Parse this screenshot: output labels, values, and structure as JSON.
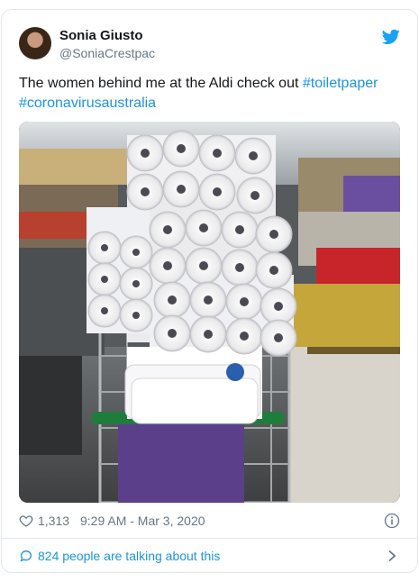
{
  "tweet": {
    "display_name": "Sonia Giusto",
    "handle": "@SoniaCrestpac",
    "text_plain": "The women behind me at the Aldi check out ",
    "hashtag_1": "#toiletpaper",
    "hashtag_2": "#coronavirusaustralia",
    "like_count": "1,313",
    "timestamp": "9:29 AM - Mar 3, 2020",
    "talking_text": "824 people are talking about this"
  },
  "icons": {
    "brand": "twitter-bird-icon",
    "like": "heart-icon",
    "info": "info-icon",
    "reply": "speech-bubble-icon",
    "chevron": "chevron-right-icon"
  },
  "colors": {
    "link": "#1b95e0",
    "meta": "#657786",
    "border": "#e1e8ed",
    "brand": "#1da1f2"
  }
}
